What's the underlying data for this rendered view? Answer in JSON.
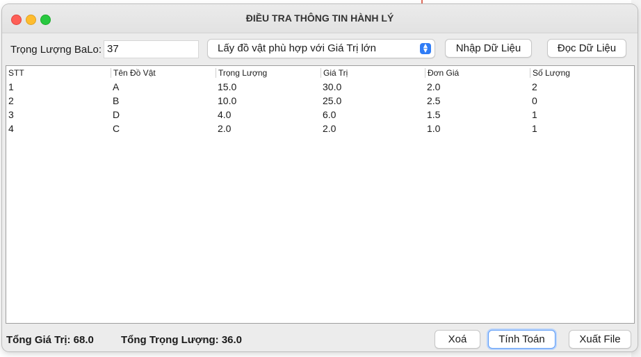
{
  "window": {
    "title": "ĐIỀU TRA THÔNG TIN HÀNH LÝ"
  },
  "controls": {
    "weight_label": "Trọng Lượng BaLo:",
    "weight_value": "37",
    "strategy_selected": "Lấy đồ vật phù hợp với Giá Trị lớn",
    "import_label": "Nhập Dữ Liệu",
    "read_label": "Đọc Dữ Liệu"
  },
  "table": {
    "columns": [
      "STT",
      "Tên Đồ Vật",
      "Trọng Lượng",
      "Giá Trị",
      "Đơn Giá",
      "Số Lượng"
    ],
    "rows": [
      [
        "1",
        "A",
        "15.0",
        "30.0",
        "2.0",
        "2"
      ],
      [
        "2",
        "B",
        "10.0",
        "25.0",
        "2.5",
        "0"
      ],
      [
        "3",
        "D",
        "4.0",
        "6.0",
        "1.5",
        "1"
      ],
      [
        "4",
        "C",
        "2.0",
        "2.0",
        "1.0",
        "1"
      ]
    ]
  },
  "footer": {
    "total_value": "Tổng Giá Trị: 68.0",
    "total_weight": "Tổng Trọng Lượng: 36.0",
    "delete_label": "Xoá",
    "compute_label": "Tính Toán",
    "export_label": "Xuất File"
  },
  "icons": {
    "close": "close-button-red",
    "minimize": "minimize-button-yellow",
    "maximize": "maximize-button-green",
    "select_arrows": "up-down-chevron-icon"
  },
  "colors": {
    "close": "#fe5f57",
    "minimize": "#febc2e",
    "maximize": "#28c840",
    "accent": "#2f7cf6"
  }
}
